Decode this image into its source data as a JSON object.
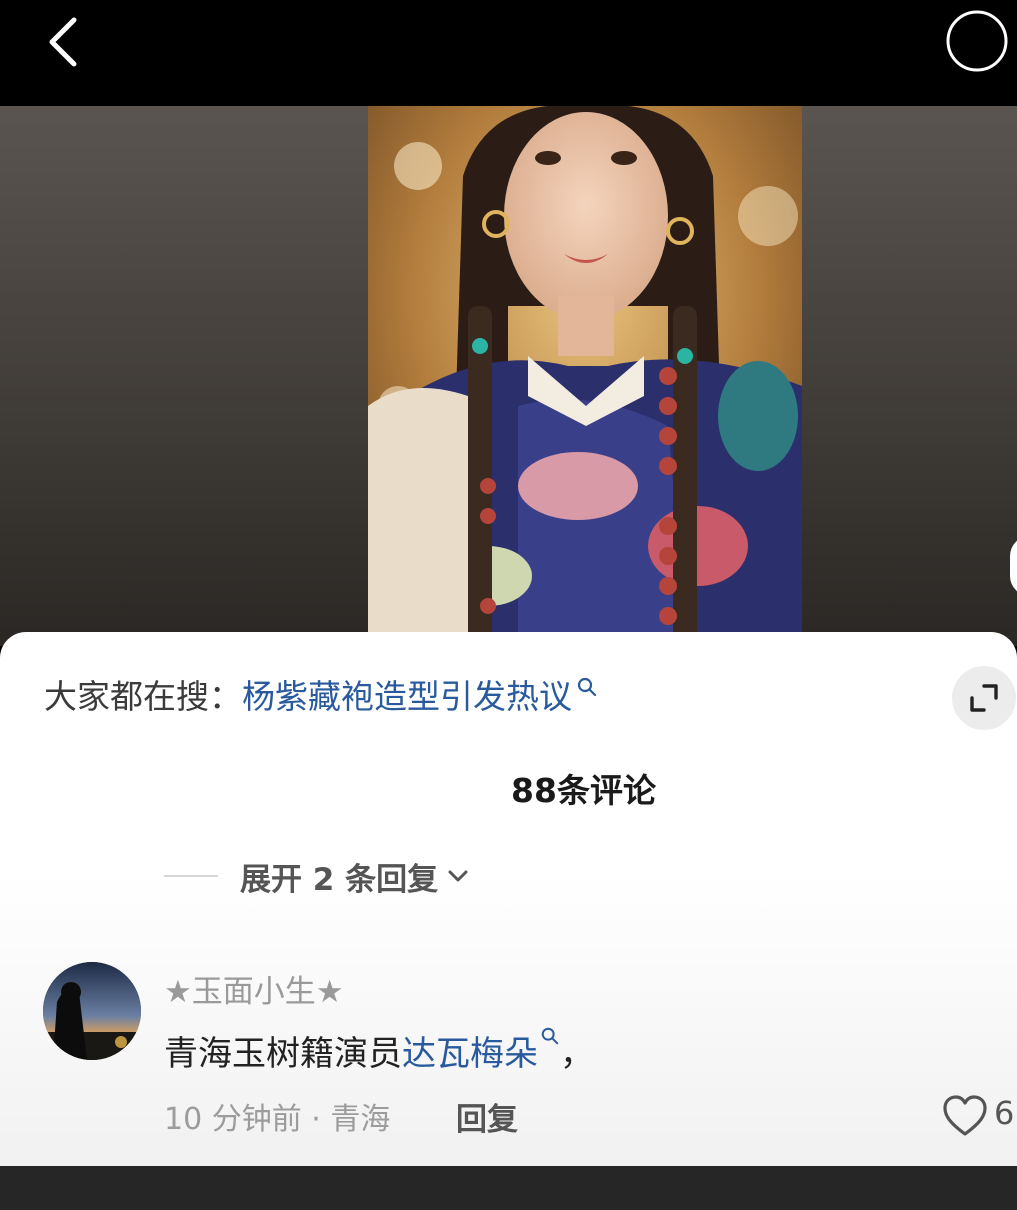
{
  "colors": {
    "link": "#2a5a9e",
    "background_top": "#000000",
    "sheet": "#ffffff",
    "bottom_strip": "#262626"
  },
  "icons": {
    "back": "chevron-left-icon",
    "top_right": "circle-icon",
    "search_small": "search-icon",
    "expand": "expand-icon",
    "chevron": "chevron-down-icon",
    "like": "heart-icon"
  },
  "search": {
    "prefix": "大家都在搜：",
    "query": "杨紫藏袍造型引发热议"
  },
  "comments": {
    "count_label": "88条评论",
    "expand_replies": "展开 2 条回复"
  },
  "comment": {
    "username": "★玉面小生★",
    "text_prefix": "青海玉树籍演员",
    "text_link": "达瓦梅朵",
    "text_suffix": "，",
    "meta": "10 分钟前 · 青海",
    "reply_label": "回复",
    "likes": "6"
  }
}
